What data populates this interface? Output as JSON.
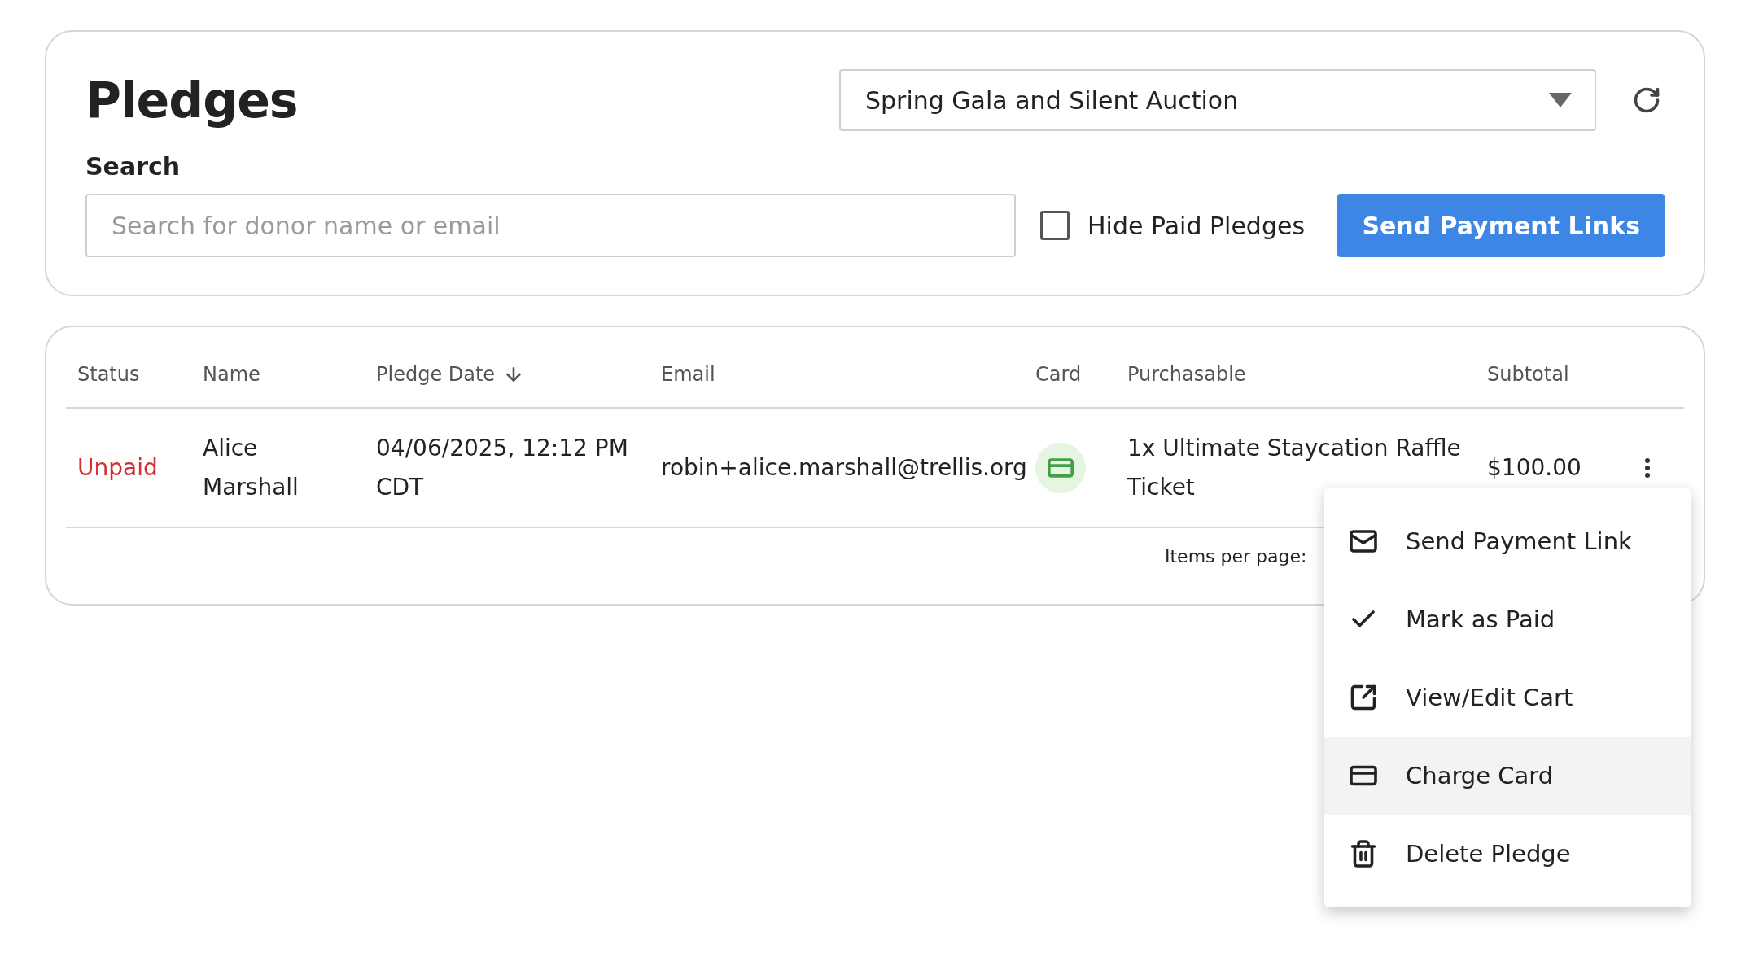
{
  "header": {
    "title": "Pledges",
    "event_select": {
      "value": "Spring Gala and Silent Auction"
    },
    "search": {
      "label": "Search",
      "placeholder": "Search for donor name or email"
    },
    "hide_paid": {
      "label": "Hide Paid Pledges",
      "checked": false
    },
    "send_button": "Send Payment Links"
  },
  "table": {
    "columns": [
      {
        "label": "Status",
        "sorted": false
      },
      {
        "label": "Name",
        "sorted": false
      },
      {
        "label": "Pledge Date",
        "sorted": true
      },
      {
        "label": "Email",
        "sorted": false
      },
      {
        "label": "Card",
        "sorted": false
      },
      {
        "label": "Purchasable",
        "sorted": false
      },
      {
        "label": "Subtotal",
        "sorted": false
      }
    ],
    "rows": [
      {
        "status": "Unpaid",
        "paid": false,
        "name": "Alice Marshall",
        "pledge_date": "04/06/2025, 12:12 PM CDT",
        "email": "robin+alice.marshall@trellis.org",
        "card_on_file": true,
        "purchasable": "1x Ultimate Staycation Raffle Ticket",
        "subtotal": "$100.00"
      }
    ],
    "footer": {
      "items_per_page": "Items per page:"
    }
  },
  "row_menu": {
    "items": [
      {
        "kind": "mail",
        "label": "Send Payment Link",
        "highlighted": false
      },
      {
        "kind": "check",
        "label": "Mark as Paid",
        "highlighted": false
      },
      {
        "kind": "external",
        "label": "View/Edit Cart",
        "highlighted": false
      },
      {
        "kind": "card",
        "label": "Charge Card",
        "highlighted": true
      },
      {
        "kind": "trash",
        "label": "Delete Pledge",
        "highlighted": false
      }
    ]
  }
}
